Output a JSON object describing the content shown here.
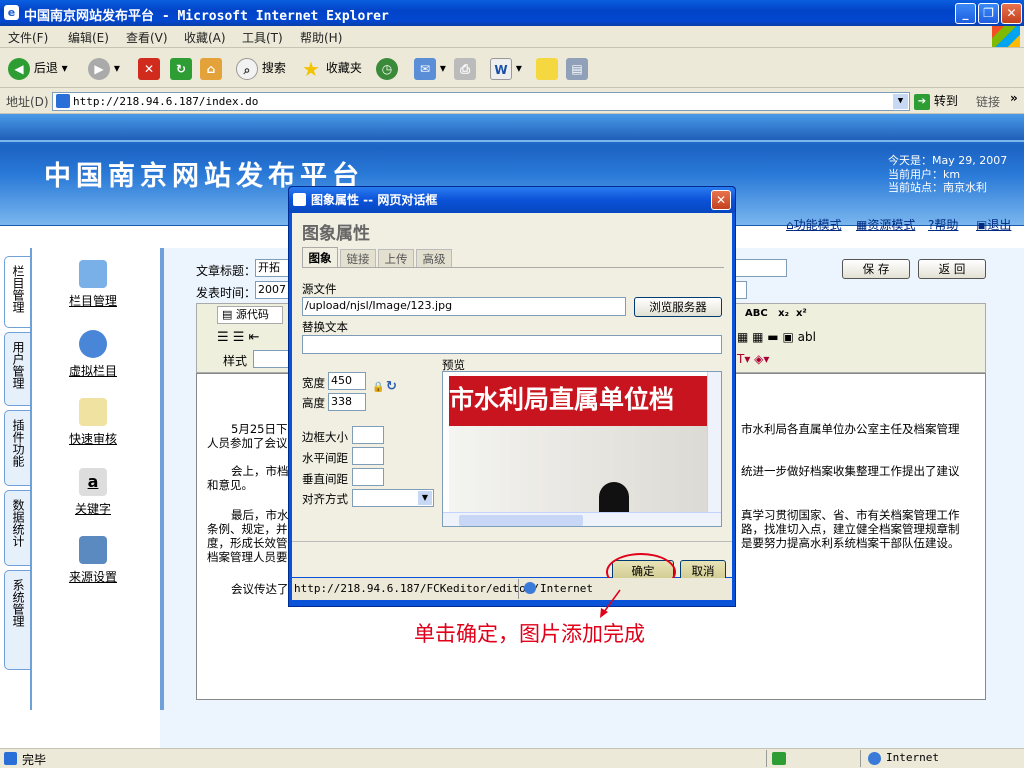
{
  "window": {
    "title": "中国南京网站发布平台 - Microsoft Internet Explorer"
  },
  "menu": [
    "文件(F)",
    "编辑(E)",
    "查看(V)",
    "收藏(A)",
    "工具(T)",
    "帮助(H)"
  ],
  "toolbar": {
    "back": "后退",
    "search": "搜索",
    "favorites": "收藏夹"
  },
  "address": {
    "label": "地址(D)",
    "url": "http://218.94.6.187/index.do",
    "go": "转到",
    "links": "链接"
  },
  "site": {
    "title": "中国南京网站发布平台",
    "today": "今天是：May 29, 2007",
    "user": "当前用户：km",
    "station": "当前站点：南京水利"
  },
  "modes": {
    "function_mode": "功能模式",
    "resource_mode": "资源模式",
    "help": "帮助",
    "logout": "退出"
  },
  "sidebar": {
    "tabs": [
      "栏目管理",
      "用户管理",
      "插件功能",
      "数据统计",
      "系统管理"
    ],
    "items": [
      "栏目管理",
      "虚拟栏目",
      "快速审核",
      "关键字",
      "来源设置"
    ]
  },
  "article": {
    "title_label": "文章标题：",
    "title_value": "开拓",
    "time_label": "发表时间：",
    "time_value": "2007",
    "save": "保 存",
    "back": "返 回"
  },
  "editor": {
    "source_btn": "源代码",
    "style_label": "样式",
    "p1": "5月25日下",
    "p1b": "市水利局各直属单位办公室主任及档案管理",
    "p1c": "人员参加了会议",
    "p2": "会上，市档",
    "p2b": "统进一步做好档案收集整理工作提出了建议",
    "p2c": "和意见。",
    "p3": "最后，市水",
    "p3b": "真学习贯彻国家、省、市有关档案管理工作",
    "p3c": "条例、规定，并",
    "p3d": "路，找准切入点，建立健全档案管理规章制",
    "p3e": "度，形成长效管",
    "p3f": "是要努力提高水利系统档案干部队伍建设。",
    "p3g": "档案管理人员要",
    "p4": "会议传达了"
  },
  "dialog": {
    "title": "图象属性 -- 网页对话框",
    "heading": "图象属性",
    "tabs": [
      "图象",
      "链接",
      "上传",
      "高级"
    ],
    "src_label": "源文件",
    "src_value": "/upload/njsl/Image/123.jpg",
    "browse": "浏览服务器",
    "alt_label": "替换文本",
    "width_label": "宽度",
    "width_value": "450",
    "height_label": "高度",
    "height_value": "338",
    "border_label": "边框大小",
    "hspace_label": "水平间距",
    "vspace_label": "垂直间距",
    "align_label": "对齐方式",
    "preview_label": "预览",
    "preview_text": "市水利局直属单位档",
    "ok": "确定",
    "cancel": "取消",
    "status_url": "http://218.94.6.187/FCKeditor/editor/",
    "status_zone": "Internet"
  },
  "annotation": "单击确定，图片添加完成",
  "status": {
    "done": "完毕",
    "zone": "Internet"
  },
  "colors": {
    "xp_blue": "#0a52d8",
    "banner": "#2a7ad8",
    "annotation": "#e0001a",
    "banner_red": "#c8141e"
  }
}
